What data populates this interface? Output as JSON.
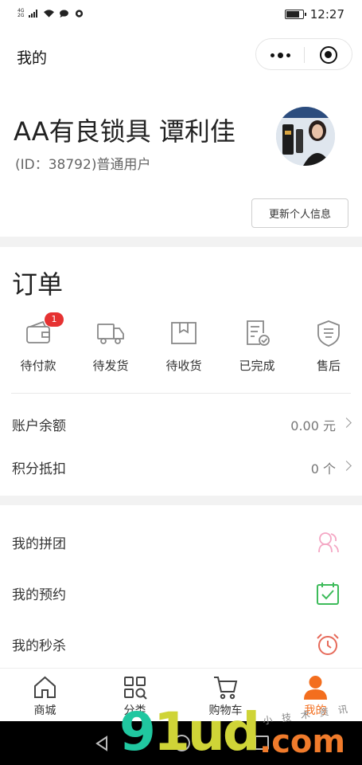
{
  "status_bar": {
    "network_top": "4G",
    "network_bottom": "2G",
    "time": "12:27",
    "battery_level_percent": 85,
    "icons": [
      "signal-icon",
      "wifi-icon",
      "message-icon",
      "app-icon",
      "battery-icon"
    ]
  },
  "navbar": {
    "title": "我的",
    "icons": [
      "more-icon",
      "close-circle-icon"
    ]
  },
  "profile": {
    "name": "AA有良锁具 谭利佳",
    "subtitle": "(ID：38792)普通用户",
    "update_button": "更新个人信息"
  },
  "orders": {
    "title": "订单",
    "items": [
      {
        "label": "待付款",
        "icon": "wallet-icon",
        "badge": "1"
      },
      {
        "label": "待发货",
        "icon": "truck-icon",
        "badge": ""
      },
      {
        "label": "待收货",
        "icon": "package-icon",
        "badge": ""
      },
      {
        "label": "已完成",
        "icon": "document-check-icon",
        "badge": ""
      },
      {
        "label": "售后",
        "icon": "after-sales-icon",
        "badge": ""
      }
    ]
  },
  "account": {
    "balance_label": "账户余额",
    "balance_value": "0.00 元",
    "points_label": "积分抵扣",
    "points_value": "0 个"
  },
  "services": [
    {
      "label": "我的拼团",
      "icon": "group-buy-icon",
      "color": "#f4a7c4"
    },
    {
      "label": "我的预约",
      "icon": "calendar-check-icon",
      "color": "#3dbb5a"
    },
    {
      "label": "我的秒杀",
      "icon": "alarm-clock-icon",
      "color": "#e66a5a"
    }
  ],
  "tabbar": {
    "tabs": [
      {
        "label": "商城",
        "icon": "home-icon"
      },
      {
        "label": "分类",
        "icon": "category-icon"
      },
      {
        "label": "购物车",
        "icon": "cart-icon"
      },
      {
        "label": "我的",
        "icon": "user-icon",
        "active": true
      }
    ]
  },
  "colors": {
    "accent": "#f36e1e",
    "badge": "#e63232",
    "page_bg": "#f2f2f2"
  },
  "watermark": {
    "main_a": "9",
    "main_b": "1ud",
    "suffix": ".com",
    "tag": "小 技 术 资 讯"
  }
}
